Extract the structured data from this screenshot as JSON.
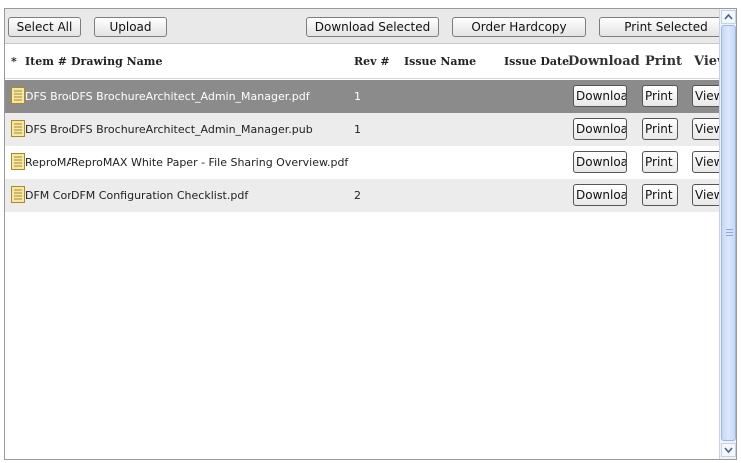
{
  "toolbar": {
    "select_all": "Select All",
    "upload": "Upload",
    "download_selected": "Download Selected",
    "order_hardcopy": "Order Hardcopy",
    "print_selected": "Print Selected"
  },
  "table": {
    "headers": {
      "star": "*",
      "item": "Item #",
      "drawing_name": "Drawing Name",
      "rev": "Rev #",
      "issue_name": "Issue Name",
      "issue_date": "Issue Date",
      "download": "Download",
      "print": "Print",
      "view": "View"
    },
    "rows": [
      {
        "item": "DFS Broc",
        "drawing_name": "DFS BrochureArchitect_Admin_Manager.pdf",
        "rev": "1",
        "state": "selected"
      },
      {
        "item": "DFS Broc",
        "drawing_name": "DFS BrochureArchitect_Admin_Manager.pub",
        "rev": "1",
        "state": "alt"
      },
      {
        "item": "ReproMA",
        "drawing_name": "ReproMAX White Paper - File Sharing Overview.pdf",
        "rev": "",
        "state": "plain"
      },
      {
        "item": "DFM Conf",
        "drawing_name": "DFM Configuration Checklist.pdf",
        "rev": "2",
        "state": "alt"
      }
    ],
    "row_buttons": {
      "download": "Download",
      "print": "Print",
      "view": "View"
    }
  },
  "icons": {
    "file": "document-icon"
  },
  "colors": {
    "selected_row": "#8b8b8b",
    "alt_row": "#ececec",
    "scroll_thumb": "#c6d8f7"
  }
}
